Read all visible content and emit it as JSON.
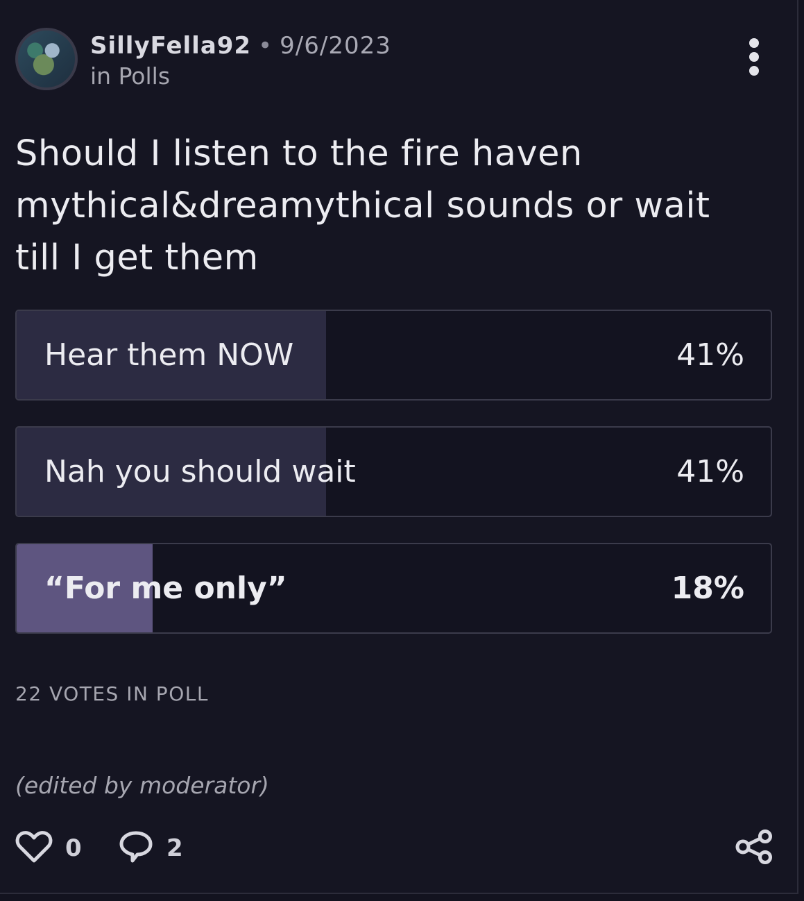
{
  "post": {
    "author": "SillyFella92",
    "separator": "•",
    "date": "9/6/2023",
    "category": "in Polls",
    "question": "Should I listen to the fire haven mythical&dreamythical sounds or wait till I get them"
  },
  "poll": {
    "options": [
      {
        "label": "Hear them NOW",
        "percent_text": "41%",
        "percent": 41,
        "selected": false
      },
      {
        "label": "Nah you should wait",
        "percent_text": "41%",
        "percent": 41,
        "selected": false
      },
      {
        "label": "“For me only”",
        "percent_text": "18%",
        "percent": 18,
        "selected": true
      }
    ],
    "votes_text": "22 VOTES IN POLL"
  },
  "footer": {
    "edited_note": "(edited by moderator)",
    "likes": "0",
    "comments": "2"
  },
  "icons": {
    "like": "heart-icon",
    "comment": "speech-bubble-icon",
    "share": "share-icon",
    "more": "more-vertical-icon"
  },
  "colors": {
    "background": "#151522",
    "bar_fill": "#2c2b42",
    "selected_fill": "#5e5580",
    "text": "#ececf1"
  }
}
